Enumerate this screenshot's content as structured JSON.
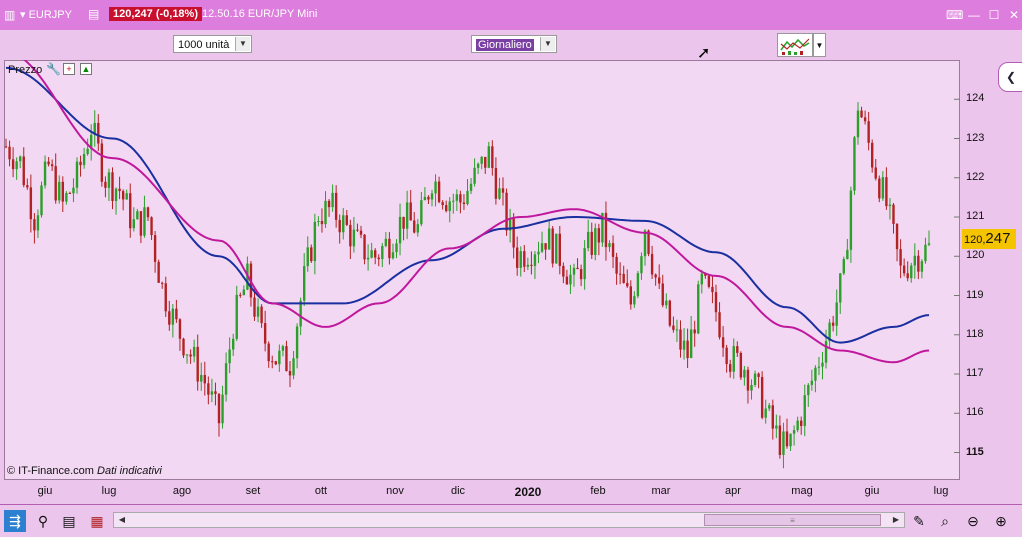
{
  "window": {
    "symbol": "EURJPY",
    "price_badge": "120,247 (-0,18%)",
    "subtitle": "12.50.16 EUR/JPY Mini",
    "icons": [
      "chart-window-icon",
      "notes-icon",
      "keyboard-icon",
      "minimize-icon",
      "maximize-icon",
      "close-icon"
    ]
  },
  "toolbar": {
    "quantity": "1000 unità",
    "period": "Giornaliero"
  },
  "chart": {
    "panel_label": "Prezzo",
    "credit_source": "© IT-Finance.com",
    "credit_note": "Dati indicativi",
    "last_price_int": "120,",
    "last_price_dec": "247",
    "colors": {
      "up": "#2aa02a",
      "down": "#b22222",
      "ma_short": "#1a2fa0",
      "ma_long": "#c0189c",
      "price_tag": "#f5c400"
    }
  },
  "chart_data": {
    "type": "candlestick",
    "ylim": [
      114.3,
      125.0
    ],
    "y_ticks": [
      "124",
      "123",
      "122",
      "121",
      "120",
      "119",
      "118",
      "117",
      "116",
      "115"
    ],
    "x_ticks": [
      "giu",
      "lug",
      "ago",
      "set",
      "ott",
      "nov",
      "dic",
      "2020",
      "feb",
      "mar",
      "apr",
      "mag",
      "giu",
      "lug"
    ],
    "close_path": [
      [
        0,
        122.8
      ],
      [
        4,
        122.4
      ],
      [
        8,
        121.0
      ],
      [
        12,
        122.3
      ],
      [
        16,
        121.3
      ],
      [
        20,
        122.0
      ],
      [
        24,
        123.3
      ],
      [
        28,
        122.0
      ],
      [
        32,
        121.7
      ],
      [
        36,
        120.8
      ],
      [
        40,
        121.0
      ],
      [
        44,
        119.2
      ],
      [
        48,
        118.2
      ],
      [
        52,
        117.5
      ],
      [
        56,
        116.8
      ],
      [
        60,
        115.8
      ],
      [
        64,
        118.3
      ],
      [
        68,
        119.4
      ],
      [
        72,
        118.0
      ],
      [
        76,
        117.4
      ],
      [
        80,
        117.3
      ],
      [
        84,
        119.4
      ],
      [
        88,
        121.1
      ],
      [
        92,
        121.2
      ],
      [
        96,
        120.7
      ],
      [
        100,
        120.2
      ],
      [
        104,
        120.0
      ],
      [
        108,
        120.4
      ],
      [
        112,
        121.0
      ],
      [
        116,
        120.7
      ],
      [
        120,
        122.0
      ],
      [
        124,
        121.5
      ],
      [
        128,
        121.4
      ],
      [
        132,
        122.0
      ],
      [
        136,
        122.6
      ],
      [
        140,
        121.2
      ],
      [
        144,
        120.0
      ],
      [
        148,
        120.2
      ],
      [
        152,
        120.5
      ],
      [
        156,
        120.0
      ],
      [
        160,
        119.3
      ],
      [
        164,
        120.2
      ],
      [
        168,
        120.7
      ],
      [
        172,
        119.5
      ],
      [
        176,
        118.8
      ],
      [
        180,
        120.8
      ],
      [
        184,
        119.0
      ],
      [
        188,
        118.0
      ],
      [
        192,
        117.5
      ],
      [
        196,
        119.3
      ],
      [
        200,
        118.6
      ],
      [
        204,
        117.4
      ],
      [
        208,
        117.2
      ],
      [
        212,
        116.5
      ],
      [
        216,
        115.6
      ],
      [
        220,
        115.0
      ],
      [
        224,
        116.0
      ],
      [
        228,
        117.1
      ],
      [
        232,
        118.2
      ],
      [
        236,
        119.5
      ],
      [
        240,
        123.9
      ],
      [
        244,
        122.5
      ],
      [
        248,
        121.3
      ],
      [
        252,
        119.6
      ],
      [
        256,
        120.0
      ],
      [
        260,
        120.2
      ]
    ],
    "series": [
      {
        "name": "",
        "color": "#1a2fa0",
        "points": [
          [
            0,
            124.8
          ],
          [
            30,
            123.0
          ],
          [
            60,
            120.0
          ],
          [
            75,
            118.8
          ],
          [
            95,
            118.8
          ],
          [
            120,
            119.9
          ],
          [
            140,
            120.7
          ],
          [
            160,
            121.0
          ],
          [
            180,
            120.9
          ],
          [
            200,
            120.1
          ],
          [
            220,
            118.7
          ],
          [
            235,
            117.8
          ],
          [
            250,
            118.2
          ],
          [
            260,
            118.5
          ]
        ]
      },
      {
        "name": "",
        "color": "#c0189c",
        "points": [
          [
            0,
            125.2
          ],
          [
            30,
            122.5
          ],
          [
            60,
            120.4
          ],
          [
            75,
            118.8
          ],
          [
            90,
            118.2
          ],
          [
            105,
            118.8
          ],
          [
            125,
            120.2
          ],
          [
            145,
            121.0
          ],
          [
            160,
            121.2
          ],
          [
            180,
            120.6
          ],
          [
            200,
            119.5
          ],
          [
            220,
            118.2
          ],
          [
            235,
            117.6
          ],
          [
            250,
            117.3
          ],
          [
            260,
            117.6
          ]
        ]
      }
    ]
  }
}
